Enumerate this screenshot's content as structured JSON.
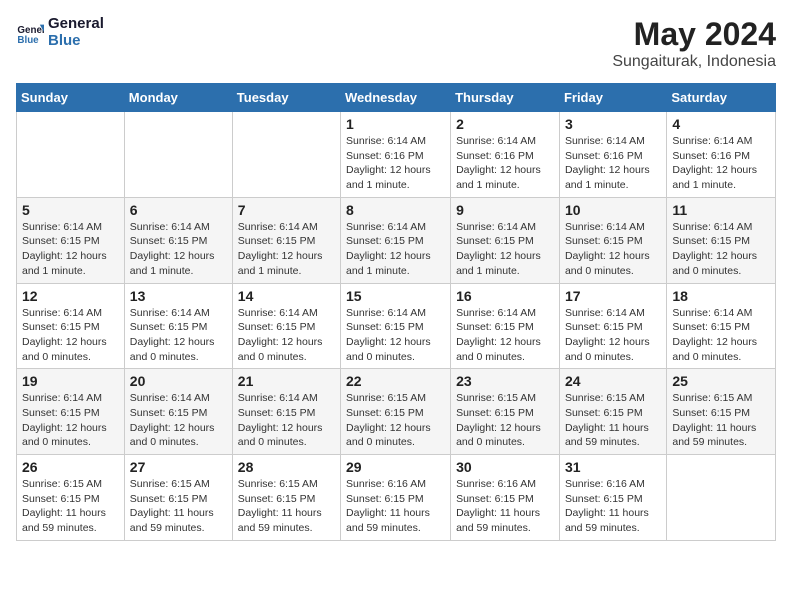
{
  "logo": {
    "line1": "General",
    "line2": "Blue"
  },
  "title": {
    "month_year": "May 2024",
    "location": "Sungaiturak, Indonesia"
  },
  "headers": [
    "Sunday",
    "Monday",
    "Tuesday",
    "Wednesday",
    "Thursday",
    "Friday",
    "Saturday"
  ],
  "weeks": [
    [
      {
        "num": "",
        "info": ""
      },
      {
        "num": "",
        "info": ""
      },
      {
        "num": "",
        "info": ""
      },
      {
        "num": "1",
        "info": "Sunrise: 6:14 AM\nSunset: 6:16 PM\nDaylight: 12 hours\nand 1 minute."
      },
      {
        "num": "2",
        "info": "Sunrise: 6:14 AM\nSunset: 6:16 PM\nDaylight: 12 hours\nand 1 minute."
      },
      {
        "num": "3",
        "info": "Sunrise: 6:14 AM\nSunset: 6:16 PM\nDaylight: 12 hours\nand 1 minute."
      },
      {
        "num": "4",
        "info": "Sunrise: 6:14 AM\nSunset: 6:16 PM\nDaylight: 12 hours\nand 1 minute."
      }
    ],
    [
      {
        "num": "5",
        "info": "Sunrise: 6:14 AM\nSunset: 6:15 PM\nDaylight: 12 hours\nand 1 minute."
      },
      {
        "num": "6",
        "info": "Sunrise: 6:14 AM\nSunset: 6:15 PM\nDaylight: 12 hours\nand 1 minute."
      },
      {
        "num": "7",
        "info": "Sunrise: 6:14 AM\nSunset: 6:15 PM\nDaylight: 12 hours\nand 1 minute."
      },
      {
        "num": "8",
        "info": "Sunrise: 6:14 AM\nSunset: 6:15 PM\nDaylight: 12 hours\nand 1 minute."
      },
      {
        "num": "9",
        "info": "Sunrise: 6:14 AM\nSunset: 6:15 PM\nDaylight: 12 hours\nand 1 minute."
      },
      {
        "num": "10",
        "info": "Sunrise: 6:14 AM\nSunset: 6:15 PM\nDaylight: 12 hours\nand 0 minutes."
      },
      {
        "num": "11",
        "info": "Sunrise: 6:14 AM\nSunset: 6:15 PM\nDaylight: 12 hours\nand 0 minutes."
      }
    ],
    [
      {
        "num": "12",
        "info": "Sunrise: 6:14 AM\nSunset: 6:15 PM\nDaylight: 12 hours\nand 0 minutes."
      },
      {
        "num": "13",
        "info": "Sunrise: 6:14 AM\nSunset: 6:15 PM\nDaylight: 12 hours\nand 0 minutes."
      },
      {
        "num": "14",
        "info": "Sunrise: 6:14 AM\nSunset: 6:15 PM\nDaylight: 12 hours\nand 0 minutes."
      },
      {
        "num": "15",
        "info": "Sunrise: 6:14 AM\nSunset: 6:15 PM\nDaylight: 12 hours\nand 0 minutes."
      },
      {
        "num": "16",
        "info": "Sunrise: 6:14 AM\nSunset: 6:15 PM\nDaylight: 12 hours\nand 0 minutes."
      },
      {
        "num": "17",
        "info": "Sunrise: 6:14 AM\nSunset: 6:15 PM\nDaylight: 12 hours\nand 0 minutes."
      },
      {
        "num": "18",
        "info": "Sunrise: 6:14 AM\nSunset: 6:15 PM\nDaylight: 12 hours\nand 0 minutes."
      }
    ],
    [
      {
        "num": "19",
        "info": "Sunrise: 6:14 AM\nSunset: 6:15 PM\nDaylight: 12 hours\nand 0 minutes."
      },
      {
        "num": "20",
        "info": "Sunrise: 6:14 AM\nSunset: 6:15 PM\nDaylight: 12 hours\nand 0 minutes."
      },
      {
        "num": "21",
        "info": "Sunrise: 6:14 AM\nSunset: 6:15 PM\nDaylight: 12 hours\nand 0 minutes."
      },
      {
        "num": "22",
        "info": "Sunrise: 6:15 AM\nSunset: 6:15 PM\nDaylight: 12 hours\nand 0 minutes."
      },
      {
        "num": "23",
        "info": "Sunrise: 6:15 AM\nSunset: 6:15 PM\nDaylight: 12 hours\nand 0 minutes."
      },
      {
        "num": "24",
        "info": "Sunrise: 6:15 AM\nSunset: 6:15 PM\nDaylight: 11 hours\nand 59 minutes."
      },
      {
        "num": "25",
        "info": "Sunrise: 6:15 AM\nSunset: 6:15 PM\nDaylight: 11 hours\nand 59 minutes."
      }
    ],
    [
      {
        "num": "26",
        "info": "Sunrise: 6:15 AM\nSunset: 6:15 PM\nDaylight: 11 hours\nand 59 minutes."
      },
      {
        "num": "27",
        "info": "Sunrise: 6:15 AM\nSunset: 6:15 PM\nDaylight: 11 hours\nand 59 minutes."
      },
      {
        "num": "28",
        "info": "Sunrise: 6:15 AM\nSunset: 6:15 PM\nDaylight: 11 hours\nand 59 minutes."
      },
      {
        "num": "29",
        "info": "Sunrise: 6:16 AM\nSunset: 6:15 PM\nDaylight: 11 hours\nand 59 minutes."
      },
      {
        "num": "30",
        "info": "Sunrise: 6:16 AM\nSunset: 6:15 PM\nDaylight: 11 hours\nand 59 minutes."
      },
      {
        "num": "31",
        "info": "Sunrise: 6:16 AM\nSunset: 6:15 PM\nDaylight: 11 hours\nand 59 minutes."
      },
      {
        "num": "",
        "info": ""
      }
    ]
  ]
}
